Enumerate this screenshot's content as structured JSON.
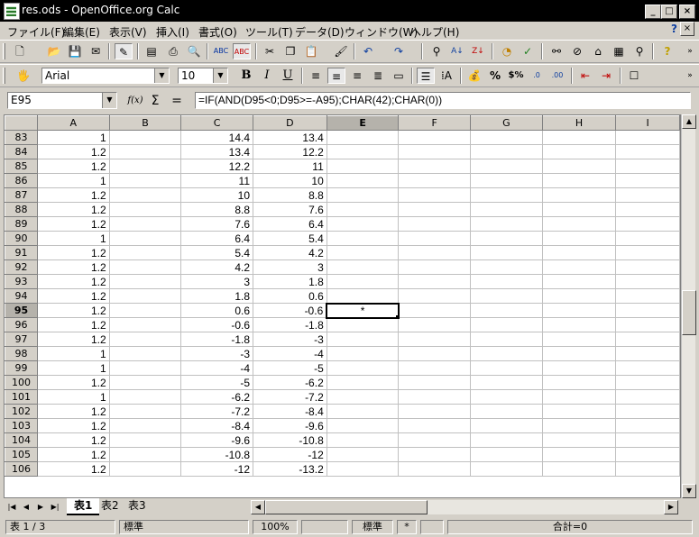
{
  "window": {
    "title": "res.ods - OpenOffice.org Calc",
    "min_label": "_",
    "max_label": "□",
    "close_label": "×"
  },
  "menu": [
    "ファイル(F)",
    "編集(E)",
    "表示(V)",
    "挿入(I)",
    "書式(O)",
    "ツール(T)",
    "データ(D)",
    "ウィンドウ(W)",
    "ヘルプ(H)"
  ],
  "help_icon": "?",
  "doc_close": "×",
  "format_toolbar": {
    "font_name": "Arial",
    "font_size": "10",
    "bold": "B",
    "italic": "I",
    "underline": "U"
  },
  "formula_bar": {
    "name_box": "E95",
    "function_wizard": "f(x)",
    "sum": "Σ",
    "equals": "=",
    "formula": "=IF(AND(D95<0;D95>=-A95);CHAR(42);CHAR(0))"
  },
  "columns": [
    "A",
    "B",
    "C",
    "D",
    "E",
    "F",
    "G",
    "H",
    "I"
  ],
  "active_column": "E",
  "active_row": "95",
  "rows": [
    {
      "n": "83",
      "A": "1",
      "C": "14.4",
      "D": "13.4",
      "E": ""
    },
    {
      "n": "84",
      "A": "1.2",
      "C": "13.4",
      "D": "12.2",
      "E": ""
    },
    {
      "n": "85",
      "A": "1.2",
      "C": "12.2",
      "D": "11",
      "E": ""
    },
    {
      "n": "86",
      "A": "1",
      "C": "11",
      "D": "10",
      "E": ""
    },
    {
      "n": "87",
      "A": "1.2",
      "C": "10",
      "D": "8.8",
      "E": ""
    },
    {
      "n": "88",
      "A": "1.2",
      "C": "8.8",
      "D": "7.6",
      "E": ""
    },
    {
      "n": "89",
      "A": "1.2",
      "C": "7.6",
      "D": "6.4",
      "E": ""
    },
    {
      "n": "90",
      "A": "1",
      "C": "6.4",
      "D": "5.4",
      "E": ""
    },
    {
      "n": "91",
      "A": "1.2",
      "C": "5.4",
      "D": "4.2",
      "E": ""
    },
    {
      "n": "92",
      "A": "1.2",
      "C": "4.2",
      "D": "3",
      "E": ""
    },
    {
      "n": "93",
      "A": "1.2",
      "C": "3",
      "D": "1.8",
      "E": ""
    },
    {
      "n": "94",
      "A": "1.2",
      "C": "1.8",
      "D": "0.6",
      "E": ""
    },
    {
      "n": "95",
      "A": "1.2",
      "C": "0.6",
      "D": "-0.6",
      "E": "*"
    },
    {
      "n": "96",
      "A": "1.2",
      "C": "-0.6",
      "D": "-1.8",
      "E": ""
    },
    {
      "n": "97",
      "A": "1.2",
      "C": "-1.8",
      "D": "-3",
      "E": ""
    },
    {
      "n": "98",
      "A": "1",
      "C": "-3",
      "D": "-4",
      "E": ""
    },
    {
      "n": "99",
      "A": "1",
      "C": "-4",
      "D": "-5",
      "E": ""
    },
    {
      "n": "100",
      "A": "1.2",
      "C": "-5",
      "D": "-6.2",
      "E": ""
    },
    {
      "n": "101",
      "A": "1",
      "C": "-6.2",
      "D": "-7.2",
      "E": ""
    },
    {
      "n": "102",
      "A": "1.2",
      "C": "-7.2",
      "D": "-8.4",
      "E": ""
    },
    {
      "n": "103",
      "A": "1.2",
      "C": "-8.4",
      "D": "-9.6",
      "E": ""
    },
    {
      "n": "104",
      "A": "1.2",
      "C": "-9.6",
      "D": "-10.8",
      "E": ""
    },
    {
      "n": "105",
      "A": "1.2",
      "C": "-10.8",
      "D": "-12",
      "E": ""
    },
    {
      "n": "106",
      "A": "1.2",
      "C": "-12",
      "D": "-13.2",
      "E": ""
    }
  ],
  "sheet_tabs": [
    "表1",
    "表2",
    "表3"
  ],
  "active_tab": "表1",
  "status": {
    "sheet": "表 1 / 3",
    "style": "標準",
    "zoom": "100%",
    "mode": "標準",
    "selection": "*",
    "sum": "合計=0"
  }
}
